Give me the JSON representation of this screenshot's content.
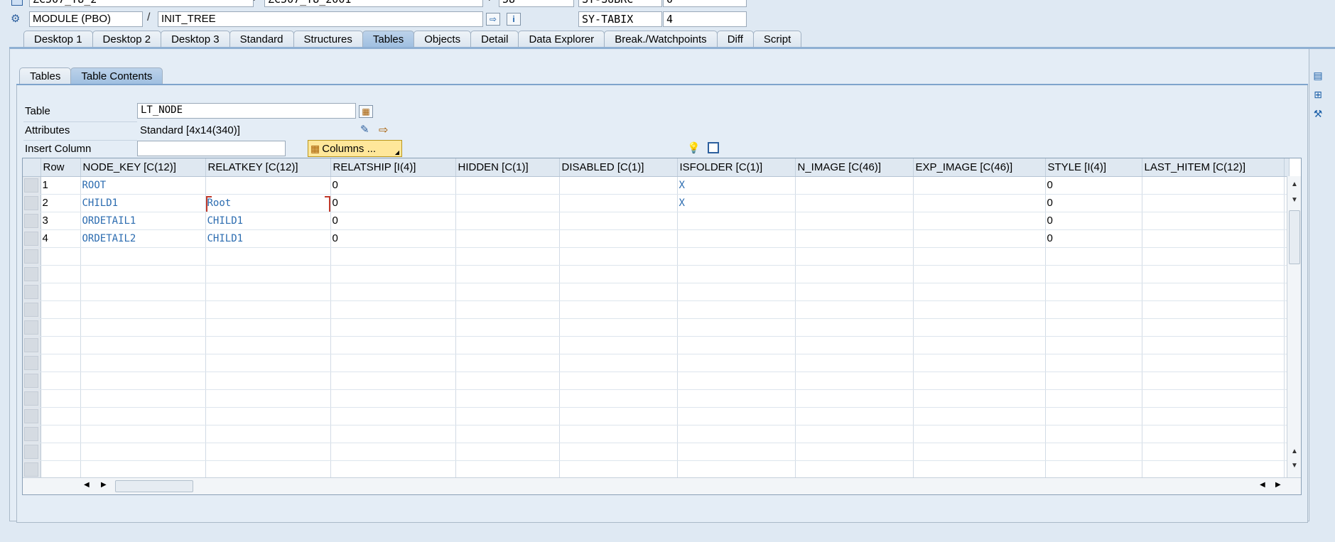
{
  "header": {
    "row0": {
      "program": "ZC507_T8_2",
      "include": "ZC507_T8_2001",
      "line": "58",
      "sysfield1": "SY-SUBRC",
      "sysval1": "0"
    },
    "row1": {
      "event_type": "MODULE (PBO)",
      "event_name": "INIT_TREE",
      "sysfield2": "SY-TABIX",
      "sysval2": "4"
    },
    "separator": "/"
  },
  "tabs": [
    "Desktop 1",
    "Desktop 2",
    "Desktop 3",
    "Standard",
    "Structures",
    "Tables",
    "Objects",
    "Detail",
    "Data Explorer",
    "Break./Watchpoints",
    "Diff",
    "Script"
  ],
  "active_tab": "Tables",
  "subtabs": [
    "Tables",
    "Table Contents"
  ],
  "active_subtab": "Table Contents",
  "form": {
    "table_label": "Table",
    "table_value": "LT_NODE",
    "attributes_label": "Attributes",
    "attributes_value": "Standard [4x14(340)]",
    "insert_column_label": "Insert Column",
    "insert_column_value": "",
    "columns_button": "Columns ..."
  },
  "grid": {
    "columns": [
      "Row",
      "NODE_KEY [C(12)]",
      "RELATKEY [C(12)]",
      "RELATSHIP [I(4)]",
      "HIDDEN [C(1)]",
      "DISABLED [C(1)]",
      "ISFOLDER [C(1)]",
      "N_IMAGE [C(46)]",
      "EXP_IMAGE [C(46)]",
      "STYLE [I(4)]",
      "LAST_HITEM [C(12)]"
    ],
    "rows": [
      [
        "1",
        "ROOT",
        "",
        "0",
        "",
        "",
        "X",
        "",
        "",
        "0",
        ""
      ],
      [
        "2",
        "CHILD1",
        "Root",
        "0",
        "",
        "",
        "X",
        "",
        "",
        "0",
        ""
      ],
      [
        "3",
        "ORDETAIL1",
        "CHILD1",
        "0",
        "",
        "",
        "",
        "",
        "",
        "0",
        ""
      ],
      [
        "4",
        "ORDETAIL2",
        "CHILD1",
        "0",
        "",
        "",
        "",
        "",
        "",
        "0",
        ""
      ]
    ],
    "empty_rows": 13
  },
  "icons": {
    "header_doc": "document-icon",
    "header_gear": "gear-icon",
    "nav": "navigate-icon",
    "info": "info-icon",
    "table_f4": "table-icon",
    "attr_edit": "edit-attributes-icon",
    "attr_nav": "navigate-arrow-icon",
    "lightbulb": "lightbulb-icon",
    "save": "save-icon"
  }
}
